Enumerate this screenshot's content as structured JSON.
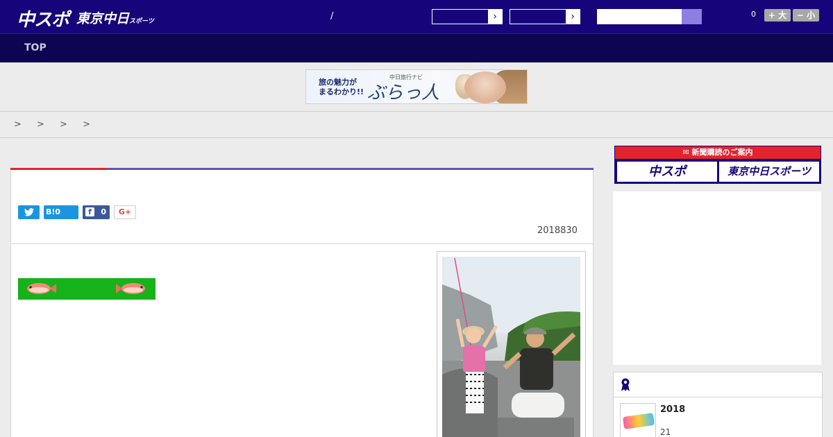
{
  "header": {
    "logo_main": "中スポ",
    "logo_tokyo": "東京中日",
    "logo_tokyo_suffix": "スポーツ",
    "separator": "/",
    "select_arrow": "›",
    "count": "0",
    "font_larger": "+ 大",
    "font_smaller": "− 小"
  },
  "nav": {
    "top_label": "TOP"
  },
  "banner": {
    "line1": "旅の魅力が",
    "line2": "まるわかり!!",
    "sub": "中日旅行ナビ",
    "title": "ぶらっ人"
  },
  "breadcrumb": {
    "text": "> > > >"
  },
  "article": {
    "date": "2018830",
    "share": {
      "hatena_label": "B!",
      "hatena_count": "0",
      "facebook_count": "0",
      "gplus_label": "G+"
    }
  },
  "sidebar": {
    "subscription_title": "新聞購読のご案内",
    "sub_logo_1": "中スポ",
    "sub_logo_2": "東京中日スポーツ",
    "ranking": {
      "item_title": "2018",
      "item_sub": "21"
    }
  },
  "colors": {
    "header_bg": "#16057a",
    "nav_bg": "#0e0552",
    "accent_red": "#e4232d",
    "accent_purple": "#6155b3",
    "twitter": "#1b95e0",
    "facebook": "#3b5998",
    "fish_banner": "#16b31a"
  }
}
